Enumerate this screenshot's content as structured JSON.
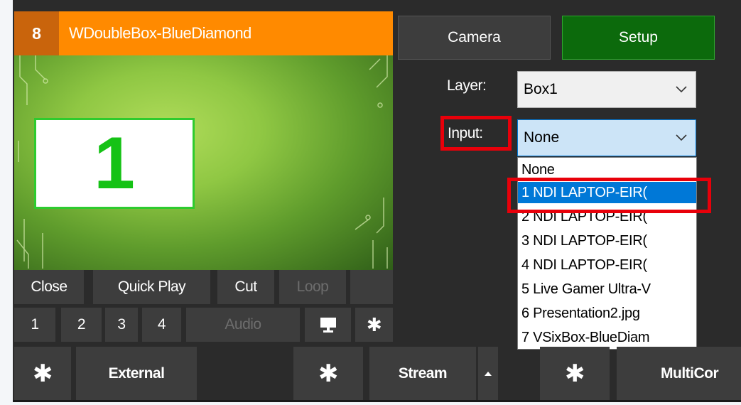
{
  "tile": {
    "number": "8",
    "title": "WDoubleBox-BlueDiamond",
    "preview_box_number": "1"
  },
  "controls": {
    "close": "Close",
    "quick_play": "Quick Play",
    "cut": "Cut",
    "loop": "Loop",
    "n1": "1",
    "n2": "2",
    "n3": "3",
    "n4": "4",
    "audio": "Audio",
    "monitor_icon": "monitor-icon",
    "settings_icon": "gear-icon"
  },
  "panel": {
    "camera": "Camera",
    "setup": "Setup",
    "layer_label": "Layer:",
    "layer_value": "Box1",
    "input_label": "Input:",
    "input_value": "None"
  },
  "dropdown": {
    "options": [
      "None",
      "1 NDI LAPTOP-EIR(",
      "2 NDI LAPTOP-EIR(",
      "3 NDI LAPTOP-EIR(",
      "4 NDI LAPTOP-EIR(",
      "5 Live Gamer Ultra-V",
      "6 Presentation2.jpg",
      "7 VSixBox-BlueDiam"
    ],
    "selected_index": 1
  },
  "toolbar": {
    "external": "External",
    "stream": "Stream",
    "multicorder": "MultiCor"
  },
  "colors": {
    "tile_header": "#ff8a00",
    "setup_active": "#0c6a0c",
    "selection": "#0078d7",
    "highlight": "#e8000a"
  }
}
